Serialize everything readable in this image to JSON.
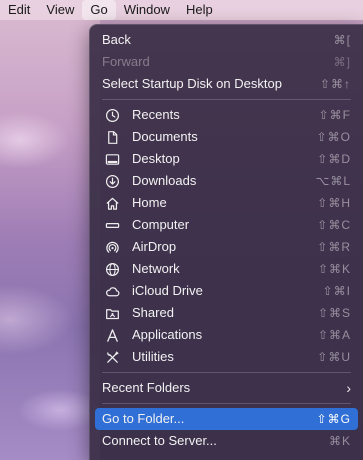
{
  "menubar": {
    "items": [
      "Edit",
      "View",
      "Go",
      "Window",
      "Help"
    ],
    "active": "Go"
  },
  "menu": {
    "top": [
      {
        "label": "Back",
        "shortcut": "⌘[",
        "disabled": false
      },
      {
        "label": "Forward",
        "shortcut": "⌘]",
        "disabled": true
      },
      {
        "label": "Select Startup Disk on Desktop",
        "shortcut": "⇧⌘↑",
        "disabled": false
      }
    ],
    "places": [
      {
        "label": "Recents",
        "shortcut": "⇧⌘F",
        "icon": "clock-icon"
      },
      {
        "label": "Documents",
        "shortcut": "⇧⌘O",
        "icon": "document-icon"
      },
      {
        "label": "Desktop",
        "shortcut": "⇧⌘D",
        "icon": "desktop-icon"
      },
      {
        "label": "Downloads",
        "shortcut": "⌥⌘L",
        "icon": "download-icon"
      },
      {
        "label": "Home",
        "shortcut": "⇧⌘H",
        "icon": "home-icon"
      },
      {
        "label": "Computer",
        "shortcut": "⇧⌘C",
        "icon": "computer-icon"
      },
      {
        "label": "AirDrop",
        "shortcut": "⇧⌘R",
        "icon": "airdrop-icon"
      },
      {
        "label": "Network",
        "shortcut": "⇧⌘K",
        "icon": "network-icon"
      },
      {
        "label": "iCloud Drive",
        "shortcut": "⇧⌘I",
        "icon": "cloud-icon"
      },
      {
        "label": "Shared",
        "shortcut": "⇧⌘S",
        "icon": "shared-folder-icon"
      },
      {
        "label": "Applications",
        "shortcut": "⇧⌘A",
        "icon": "applications-icon"
      },
      {
        "label": "Utilities",
        "shortcut": "⇧⌘U",
        "icon": "utilities-icon"
      }
    ],
    "recent_folders": {
      "label": "Recent Folders",
      "chevron": "›"
    },
    "bottom": [
      {
        "label": "Go to Folder...",
        "shortcut": "⇧⌘G",
        "highlighted": true
      },
      {
        "label": "Connect to Server...",
        "shortcut": "⌘K",
        "highlighted": false
      }
    ]
  }
}
